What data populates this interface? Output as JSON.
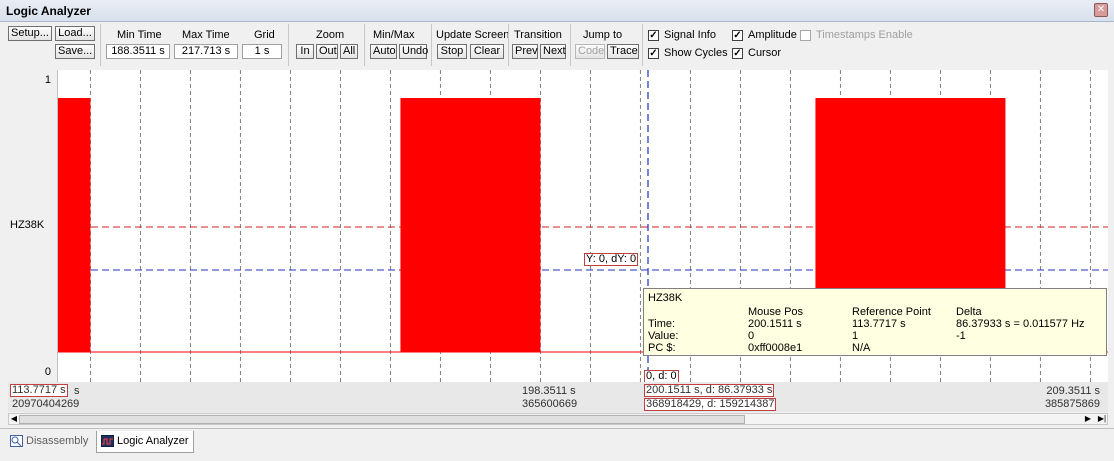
{
  "window": {
    "title": "Logic Analyzer"
  },
  "toolbar": {
    "setup_label": "Setup...",
    "load_label": "Load...",
    "save_label": "Save...",
    "min_time_label": "Min Time",
    "min_time_value": "188.3511 s",
    "max_time_label": "Max Time",
    "max_time_value": "217.713 s",
    "grid_label": "Grid",
    "grid_value": "1 s",
    "zoom_label": "Zoom",
    "zoom_in": "In",
    "zoom_out": "Out",
    "zoom_all": "All",
    "minmax_label": "Min/Max",
    "minmax_auto": "Auto",
    "minmax_undo": "Undo",
    "update_label": "Update Screen",
    "update_stop": "Stop",
    "update_clear": "Clear",
    "transition_label": "Transition",
    "transition_prev": "Prev",
    "transition_next": "Next",
    "jump_label": "Jump to",
    "jump_code": "Code",
    "jump_trace": "Trace",
    "signal_info": "Signal Info",
    "amplitude": "Amplitude",
    "timestamps_enable": "Timestamps Enable",
    "show_cycles": "Show Cycles",
    "cursor": "Cursor"
  },
  "checkboxes": {
    "signal_info": true,
    "amplitude": true,
    "timestamps_enable": false,
    "show_cycles": true,
    "cursor": true
  },
  "signal": {
    "name": "HZ38K",
    "y_top": "1",
    "y_bottom": "0",
    "color": "#ff0000",
    "pulses_time_s": [
      [
        188.3511,
        189.0
      ],
      [
        195.2,
        198.0
      ],
      [
        203.5,
        207.3
      ]
    ]
  },
  "cursor_label": "Y: 0, dY: 0",
  "mouse_label": "0, d: 0",
  "tooltip": {
    "signal": "HZ38K",
    "col_mouse": "Mouse Pos",
    "col_ref": "Reference Point",
    "col_delta": "Delta",
    "row_time": "Time:",
    "row_value": "Value:",
    "row_pc": "PC $:",
    "mouse_time": "200.1511 s",
    "mouse_value": "0",
    "mouse_pc": "0xff0008e1",
    "ref_time": "113.7717 s",
    "ref_value": "1",
    "ref_pc": "N/A",
    "delta_time": "86.37933 s = 0.011577 Hz",
    "delta_value": "-1"
  },
  "timeline": {
    "left_time": "113.7717 s",
    "left_time_suffix": "s",
    "left_cycles": "20970404269",
    "mid_time": "198.3511 s",
    "mid_cycles": "365600669",
    "cursor_time": "200.1511 s, d: 86.37933 s",
    "cursor_cycles": "368918429, d: 159214387",
    "right_time": "209.3511 s",
    "right_cycles": "385875869"
  },
  "tabs": [
    {
      "label": "Disassembly",
      "active": false
    },
    {
      "label": "Logic Analyzer",
      "active": true
    }
  ]
}
